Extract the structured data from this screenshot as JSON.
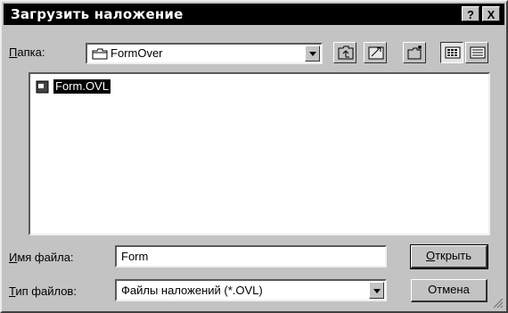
{
  "window": {
    "title": "Загрузить наложение",
    "help_btn": "?",
    "close_btn": "X"
  },
  "folder": {
    "label_first": "П",
    "label_rest": "апка:",
    "value": "FormOver"
  },
  "toolbar": {
    "buttons": [
      "up-folder-icon",
      "desktop-icon",
      "new-folder-icon",
      "list-view-icon",
      "details-view-icon"
    ]
  },
  "files": [
    {
      "name": "Form.OVL",
      "icon": "file-icon",
      "selected": true
    }
  ],
  "filename": {
    "label_first": "И",
    "label_rest": "мя файла:",
    "value": "Form"
  },
  "filetype": {
    "label_first": "Т",
    "label_rest": "ип файлов:",
    "value": "Файлы наложений (*.OVL)"
  },
  "buttons": {
    "open_first": "О",
    "open_rest": "ткрыть",
    "cancel": "Отмена"
  }
}
